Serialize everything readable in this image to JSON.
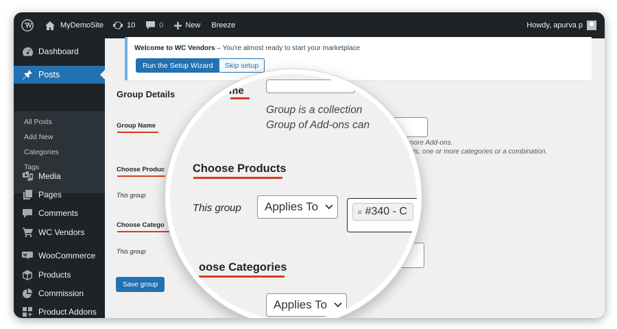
{
  "admin_bar": {
    "site_name": "MyDemoSite",
    "updates_count": "10",
    "comments_count": "0",
    "new_label": "New",
    "breeze_label": "Breeze",
    "howdy": "Howdy, apurva p"
  },
  "sidebar": {
    "dashboard": "Dashboard",
    "posts": "Posts",
    "posts_submenu": [
      "All Posts",
      "Add New",
      "Categories",
      "Tags"
    ],
    "media": "Media",
    "pages": "Pages",
    "comments": "Comments",
    "wc_vendors": "WC Vendors",
    "woocommerce": "WooCommerce",
    "products": "Products",
    "commission": "Commission",
    "product_addons": "Product Addons"
  },
  "notice": {
    "title": "Welcome to WC Vendors",
    "message": " – You're almost ready to start your marketplace",
    "setup_button": "Run the Setup Wizard",
    "skip_button": "Skip setup"
  },
  "form": {
    "heading": "Group Details",
    "group_name_label": "Group Name",
    "choose_products_label": "Choose Produc",
    "this_group_1": "This group",
    "choose_categories_label": "Choose Catego",
    "this_group_2": "This group",
    "desc_line_1": "one or more Add-ons.",
    "desc_line_2": "products, one or more categories or a combination.",
    "save_button": "Save group"
  },
  "magnifier": {
    "ghost_heading": "me",
    "ghost_line_1": "Group is a collection",
    "ghost_line_2": "Group of Add-ons can",
    "choose_products": "Choose Products",
    "this_group": "This group",
    "applies_to": "Applies To",
    "token": "#340 - C",
    "token_remove": "×",
    "choose_categories": "oose Categories",
    "applies_to_2": "Applies To"
  },
  "colors": {
    "admin_dark": "#1d2327",
    "accent_blue": "#2271b1",
    "underline_red": "#d63b1d",
    "content_bg": "#f0f0f1"
  }
}
